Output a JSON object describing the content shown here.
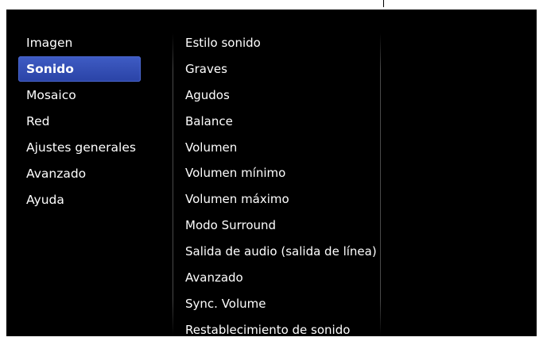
{
  "left_menu": {
    "items": [
      {
        "label": "Imagen",
        "selected": false
      },
      {
        "label": "Sonido",
        "selected": true
      },
      {
        "label": "Mosaico",
        "selected": false
      },
      {
        "label": "Red",
        "selected": false
      },
      {
        "label": "Ajustes generales",
        "selected": false
      },
      {
        "label": "Avanzado",
        "selected": false
      },
      {
        "label": "Ayuda",
        "selected": false
      }
    ]
  },
  "right_menu": {
    "items": [
      {
        "label": "Estilo sonido"
      },
      {
        "label": "Graves"
      },
      {
        "label": "Agudos"
      },
      {
        "label": "Balance"
      },
      {
        "label": "Volumen"
      },
      {
        "label": "Volumen mínimo"
      },
      {
        "label": "Volumen máximo"
      },
      {
        "label": "Modo Surround"
      },
      {
        "label": "Salida de audio (salida de línea)"
      },
      {
        "label": "Avanzado"
      },
      {
        "label": "Sync. Volume"
      },
      {
        "label": "Restablecimiento de sonido"
      }
    ]
  },
  "colors": {
    "background": "#000000",
    "selection": "#2f4bb3",
    "text": "#ffffff"
  }
}
